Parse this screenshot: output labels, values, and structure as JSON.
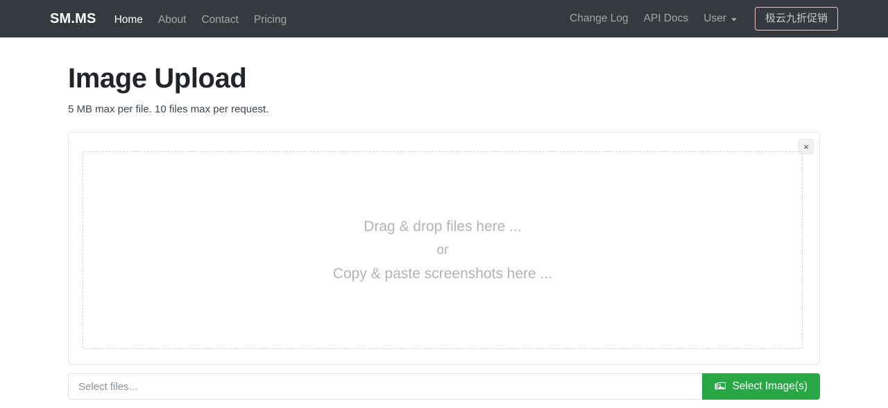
{
  "navbar": {
    "brand": "SM.MS",
    "left_links": [
      {
        "label": "Home",
        "active": true
      },
      {
        "label": "About",
        "active": false
      },
      {
        "label": "Contact",
        "active": false
      },
      {
        "label": "Pricing",
        "active": false
      }
    ],
    "right_links": [
      {
        "label": "Change Log"
      },
      {
        "label": "API Docs"
      }
    ],
    "user_label": "User",
    "promo_label": "极云九折促销",
    "background_color": "#343a40",
    "promo_border_color": "#f2c3c3"
  },
  "main": {
    "title": "Image Upload",
    "subtitle": "5 MB max per file. 10 files max per request.",
    "card": {
      "close_label": "×",
      "dropzone": {
        "line1": "Drag & drop files here ...",
        "line2": "or",
        "line3": "Copy & paste screenshots here ..."
      }
    },
    "file_input": {
      "value": "",
      "placeholder": "Select files..."
    },
    "select_button": {
      "label": "Select Image(s)",
      "icon": "images-icon",
      "color": "#28a745"
    }
  }
}
